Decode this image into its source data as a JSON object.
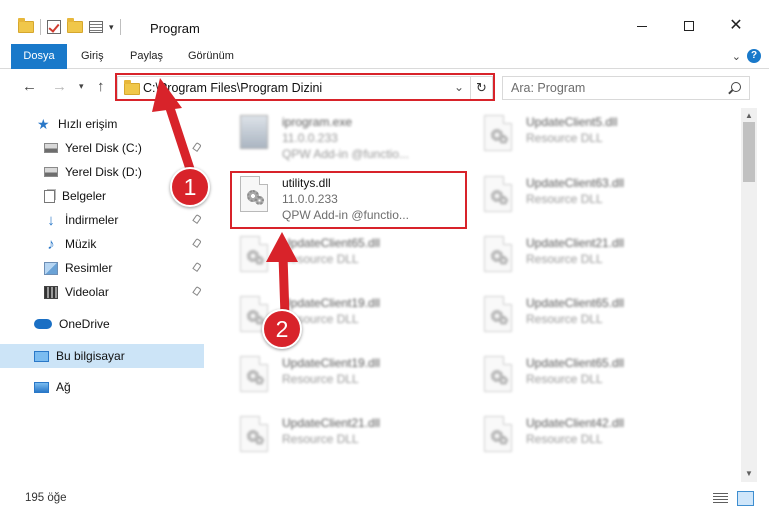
{
  "window": {
    "title": "Program"
  },
  "ribbon": {
    "tabs": [
      "Dosya",
      "Giriş",
      "Paylaş",
      "Görünüm"
    ]
  },
  "address": {
    "path": "C:\\Program Files\\Program Dizini"
  },
  "search": {
    "placeholder": "Ara: Program"
  },
  "sidebar": {
    "items": [
      {
        "label": "Hızlı erişim",
        "icon": "star-icon"
      },
      {
        "label": "Yerel Disk (C:)",
        "icon": "disk-icon"
      },
      {
        "label": "Yerel Disk (D:)",
        "icon": "disk-icon"
      },
      {
        "label": "Belgeler",
        "icon": "documents-icon"
      },
      {
        "label": "İndirmeler",
        "icon": "downloads-icon"
      },
      {
        "label": "Müzik",
        "icon": "music-icon"
      },
      {
        "label": "Resimler",
        "icon": "pictures-icon"
      },
      {
        "label": "Videolar",
        "icon": "videos-icon"
      },
      {
        "label": "OneDrive",
        "icon": "cloud-icon"
      },
      {
        "label": "Bu bilgisayar",
        "icon": "computer-icon",
        "selected": true
      },
      {
        "label": "Ağ",
        "icon": "network-icon"
      }
    ]
  },
  "files": {
    "left": [
      {
        "name": "iprogram.exe",
        "line2": "11.0.0.233",
        "line3": "QPW Add-in @functio..."
      },
      {
        "name": "utilitys.dll",
        "line2": "11.0.0.233",
        "line3": "QPW Add-in @functio..."
      },
      {
        "name": "UpdateClient65.dll",
        "line2": "Resource DLL"
      },
      {
        "name": "UpdateClient19.dll",
        "line2": "Resource DLL"
      },
      {
        "name": "UpdateClient19.dll",
        "line2": "Resource DLL"
      },
      {
        "name": "UpdateClient21.dll",
        "line2": "Resource DLL"
      }
    ],
    "right": [
      {
        "name": "UpdateClient5.dll",
        "line2": "Resource DLL"
      },
      {
        "name": "UpdateClient63.dll",
        "line2": "Resource DLL"
      },
      {
        "name": "UpdateClient21.dll",
        "line2": "Resource DLL"
      },
      {
        "name": "UpdateClient65.dll",
        "line2": "Resource DLL"
      },
      {
        "name": "UpdateClient65.dll",
        "line2": "Resource DLL"
      },
      {
        "name": "UpdateClient42.dll",
        "line2": "Resource DLL"
      }
    ]
  },
  "status": {
    "count": "195 öğe"
  },
  "annotations": {
    "badge1": "1",
    "badge2": "2",
    "color": "#d8232a"
  }
}
